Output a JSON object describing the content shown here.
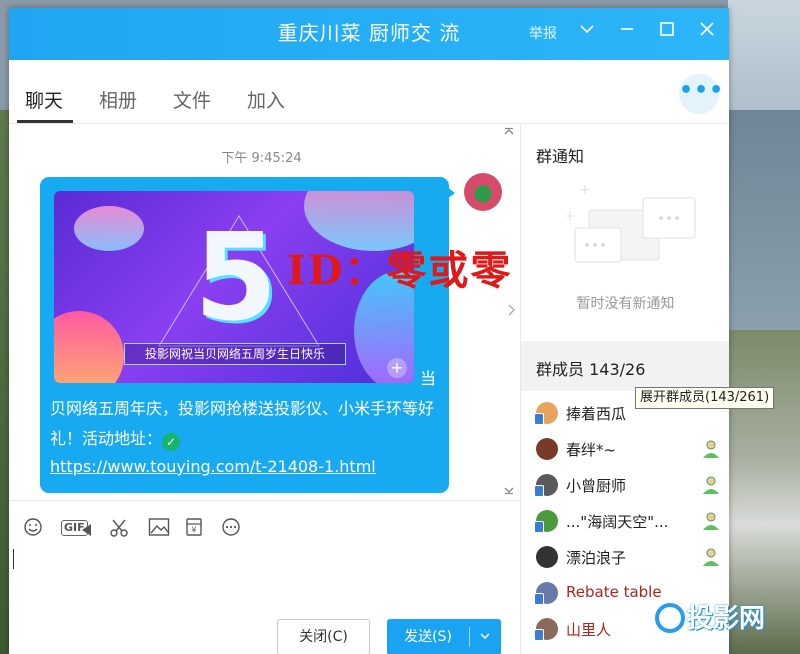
{
  "window": {
    "title": "重庆川菜 厨师交 流",
    "report_label": "举报"
  },
  "tabs": [
    {
      "label": "聊天",
      "active": true
    },
    {
      "label": "相册",
      "active": false
    },
    {
      "label": "文件",
      "active": false
    },
    {
      "label": "加入",
      "active": false
    }
  ],
  "chat": {
    "timestamp": "下午 9:45:24",
    "promo_banner_text": "投影网祝当贝网络五周岁生日快乐",
    "promo_big_glyph": "5",
    "message_dang": "当",
    "message_text": "贝网络五周年庆，投影网抢楼送投影仪、小米手环等好礼！活动地址：",
    "message_link": "https://www.touying.com/t-21408-1.html"
  },
  "watermark": {
    "id_text": "ID：零或零",
    "logo_text": "投影网"
  },
  "composer": {
    "gif_label": "GIF",
    "close_label": "关闭(C)",
    "send_label": "发送(S)"
  },
  "side": {
    "notice_title": "群通知",
    "notice_empty": "暂时没有新通知",
    "members_title": "群成员 143/26",
    "tooltip": "展开群成员(143/261)",
    "members": [
      {
        "name": "捧着西瓜",
        "red": false,
        "online": false
      },
      {
        "name": "春绊*~",
        "red": false,
        "online": true
      },
      {
        "name": "小曾厨师",
        "red": false,
        "online": true
      },
      {
        "name": "...\"海阔天空\"...",
        "red": false,
        "online": true
      },
      {
        "name": "漂泊浪子",
        "red": false,
        "online": true
      },
      {
        "name": "Rebate table",
        "red": true,
        "online": false
      },
      {
        "name": "山里人",
        "red": true,
        "online": false
      }
    ]
  },
  "colors": {
    "accent": "#1aa3f0",
    "bubble": "#18aaf0",
    "watermark_red": "#e01818"
  }
}
